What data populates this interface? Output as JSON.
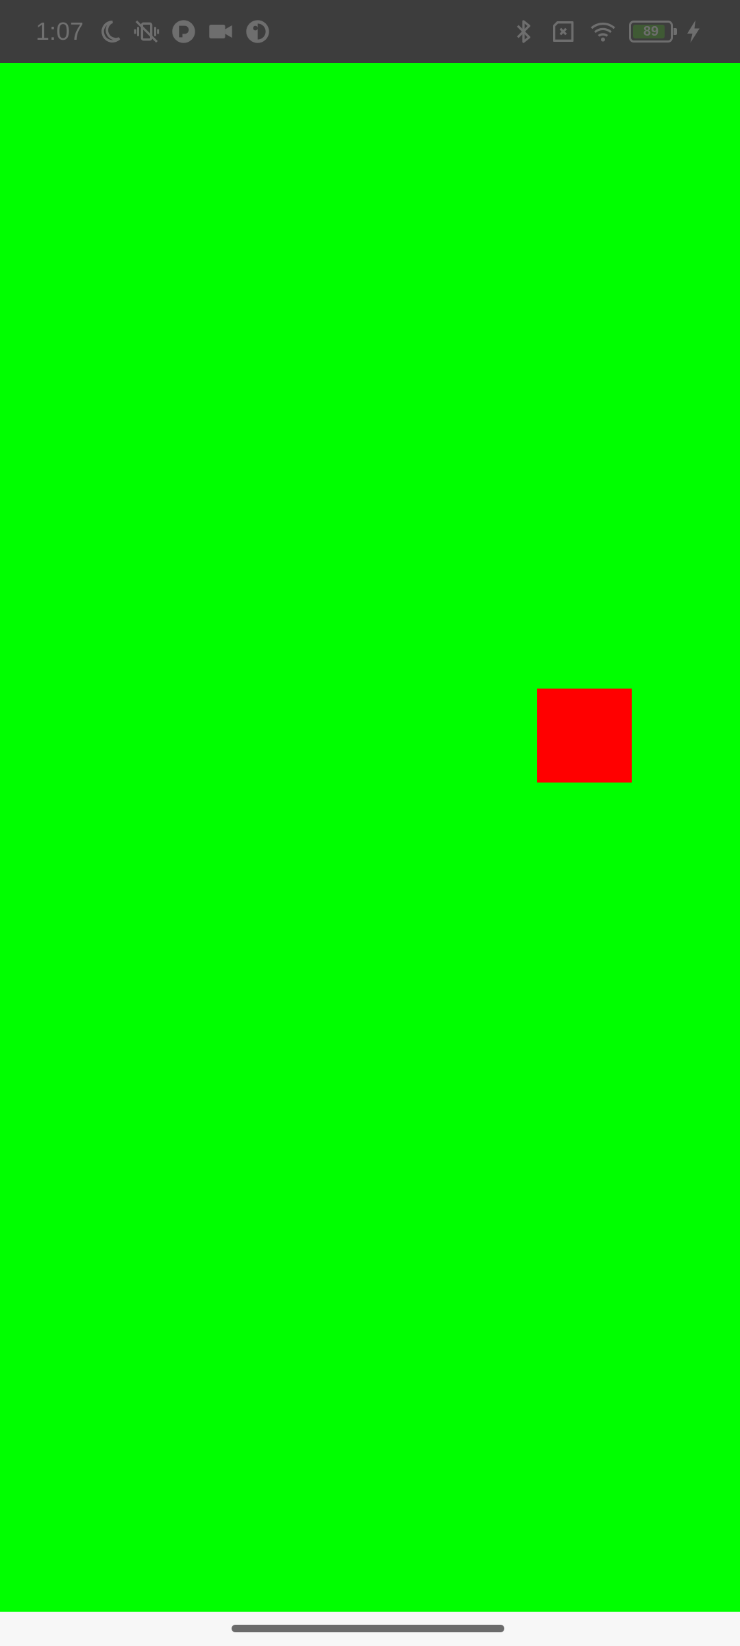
{
  "status_bar": {
    "time": "1:07",
    "battery_level": "89",
    "battery_fraction": 0.89,
    "left_icons": [
      "moon-icon",
      "vibrate-off-icon",
      "app-notification-icon",
      "video-camera-icon",
      "data-saver-icon"
    ],
    "right_icons": [
      "bluetooth-icon",
      "no-sim-icon",
      "wifi-icon",
      "battery-icon",
      "charging-bolt-icon"
    ]
  },
  "canvas": {
    "background_color": "#00ff00",
    "square_color": "#ff0000"
  }
}
